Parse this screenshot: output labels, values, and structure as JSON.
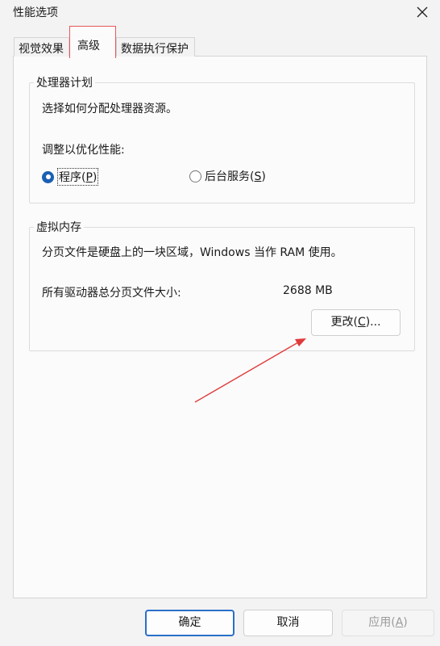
{
  "window": {
    "title": "性能选项",
    "close_icon": "close-icon"
  },
  "tabs": [
    {
      "label": "视觉效果",
      "selected": false
    },
    {
      "label": "高级",
      "selected": true
    },
    {
      "label": "数据执行保护",
      "selected": false
    }
  ],
  "processor": {
    "legend": "处理器计划",
    "description": "选择如何分配处理器资源。",
    "optimize_label": "调整以优化性能:",
    "option_programs": {
      "text": "程序(",
      "key": "P",
      "end": ")",
      "checked": true
    },
    "option_services": {
      "text": "后台服务(",
      "key": "S",
      "end": ")",
      "checked": false
    }
  },
  "virtual_memory": {
    "legend": "虚拟内存",
    "description": "分页文件是硬盘上的一块区域，Windows 当作 RAM 使用。",
    "total_label": "所有驱动器总分页文件大小:",
    "total_value": "2688 MB",
    "change_button": {
      "text": "更改(",
      "key": "C",
      "end": ")..."
    }
  },
  "footer": {
    "ok": "确定",
    "cancel": "取消",
    "apply": {
      "text": "应用(",
      "key": "A",
      "end": ")"
    }
  },
  "colors": {
    "highlight_box": "#e8585a",
    "arrow": "#e03a3a",
    "accent": "#1a5fb4"
  }
}
